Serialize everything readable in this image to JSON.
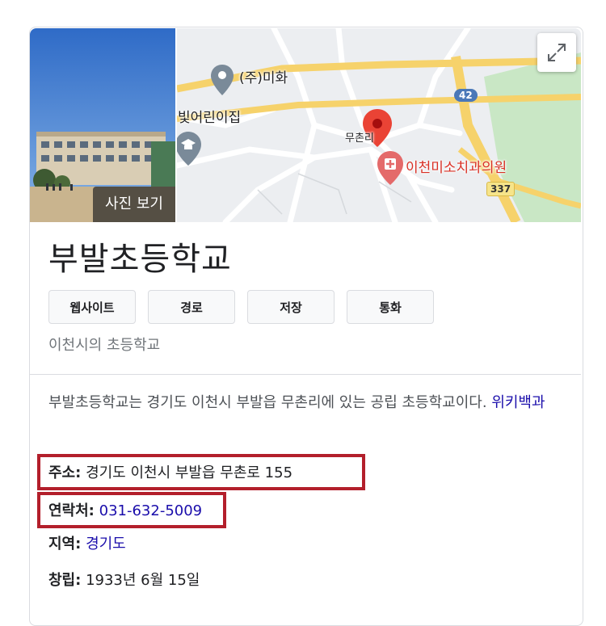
{
  "photo": {
    "view_photos_label": "사진 보기"
  },
  "map": {
    "expand_icon": "expand-icon",
    "labels": {
      "poi_mihwa": "(주)미화",
      "poi_bitgeorin": "빛어린이집",
      "village": "무촌리",
      "clinic": "이천미소치과의원",
      "route_42": "42",
      "route_337": "337"
    },
    "colors": {
      "pin": "#ea4335",
      "poi": "#7a8a99",
      "clinic": "#d93025",
      "park": "#c9e7c5",
      "road_major": "#f6d26b"
    }
  },
  "place": {
    "name": "부발초등학교",
    "category": "이천시의 초등학교"
  },
  "actions": [
    {
      "label": "웹사이트"
    },
    {
      "label": "경로"
    },
    {
      "label": "저장"
    },
    {
      "label": "통화"
    }
  ],
  "description": {
    "text": "부발초등학교는 경기도 이천시 부발읍 무촌리에 있는 공립 초등학교이다.",
    "source": "위키백과"
  },
  "facts": {
    "address": {
      "key": "주소:",
      "value": "경기도 이천시 부발읍 무촌로 155"
    },
    "phone": {
      "key": "연락처:",
      "value": "031-632-5009"
    },
    "region": {
      "key": "지역:",
      "value": "경기도"
    },
    "founded": {
      "key": "창립:",
      "value": "1933년 6월 15일"
    }
  },
  "highlight_color": "#b31f2b"
}
